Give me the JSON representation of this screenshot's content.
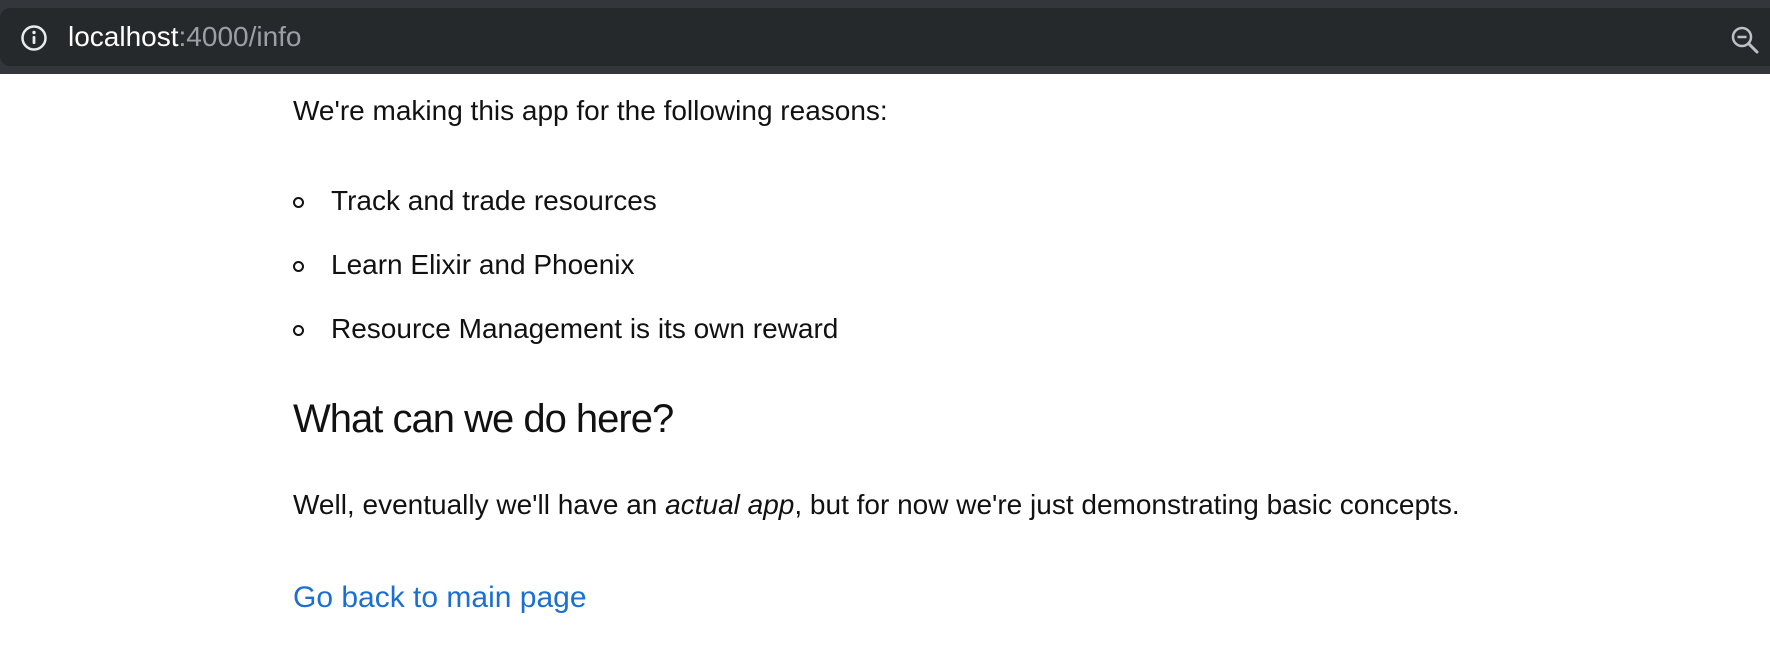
{
  "browser": {
    "url_host": "localhost",
    "url_path": ":4000/info",
    "info_icon": "info-icon",
    "zoom_icon": "zoom-out-icon"
  },
  "page": {
    "intro": "We're making this app for the following reasons:",
    "reasons": [
      "Track and trade resources",
      "Learn Elixir and Phoenix",
      "Resource Management is its own reward"
    ],
    "heading": "What can we do here?",
    "description": {
      "before": "Well, eventually we'll have an ",
      "emphasis": "actual app",
      "after": ", but for now we're just demonstrating basic concepts."
    },
    "back_link": "Go back to main page"
  },
  "colors": {
    "toolbar": "#33373b",
    "urlbar": "#26292c",
    "link": "#1a6fd0"
  }
}
